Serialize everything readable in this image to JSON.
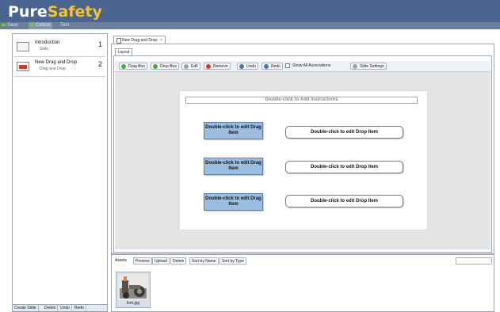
{
  "header": {
    "logo_part1": "Pure",
    "logo_part2": "Safety"
  },
  "toolbar": {
    "save": "Save",
    "cancel": "Cancel",
    "test": "Test"
  },
  "slides": [
    {
      "title": "Introduction",
      "type": "Slide",
      "number": "1"
    },
    {
      "title": "New Drag and Drop",
      "type": "Drag and Drop",
      "number": "2"
    }
  ],
  "left_buttons": {
    "create": "Create Slide",
    "delete": "Delete",
    "undo": "Undo",
    "redo": "Redo"
  },
  "editor": {
    "tab_label": "New Drag and Drop",
    "tab_close": "×",
    "layout_tab": "Layout"
  },
  "inner_toolbar": {
    "drag_box": "Drag Box",
    "drop_box": "Drop Box",
    "edit": "Edit",
    "remove": "Remove",
    "undo": "Undo",
    "redo": "Redo",
    "show_all": "Show All Associations",
    "slide_settings": "Slide Settings"
  },
  "canvas": {
    "instructions": "Double-click to Add Instructions",
    "drag_items": [
      "Double-click to edit Drag Item",
      "Double-click to edit Drag Item",
      "Double-click to edit Drag Item"
    ],
    "drop_items": [
      "Double-click to edit Drop Item",
      "Double-click to edit Drop Item",
      "Double-click to edit Drop Item"
    ]
  },
  "assets": {
    "label": "Assets",
    "preview": "Preview",
    "upload": "Upload",
    "delete": "Delete",
    "sort_name": "Sort by Name",
    "sort_type": "Sort by Type",
    "files": [
      {
        "name": "fork.jpg"
      }
    ]
  },
  "colors": {
    "header_bg": "#4a6590",
    "logo_accent": "#f6c32a",
    "drag_fill": "#9cbde0"
  }
}
